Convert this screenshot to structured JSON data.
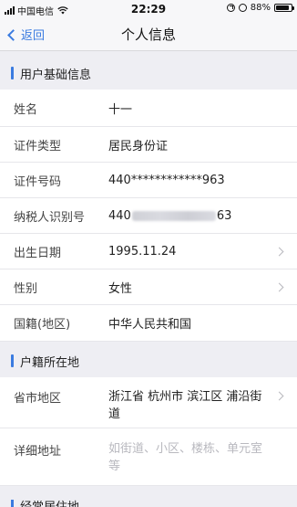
{
  "status_bar": {
    "carrier": "中国电信",
    "time": "22:29",
    "battery": "88%",
    "battery_level": 0.88
  },
  "nav": {
    "back_label": "返回",
    "title": "个人信息"
  },
  "sections": {
    "basic": {
      "title": "用户基础信息",
      "rows": [
        {
          "label": "姓名",
          "value": "十一"
        },
        {
          "label": "证件类型",
          "value": "居民身份证"
        },
        {
          "label": "证件号码",
          "value": "440************963"
        },
        {
          "label": "纳税人识别号",
          "value_prefix": "440",
          "value_suffix": "63"
        },
        {
          "label": "出生日期",
          "value": "1995.11.24"
        },
        {
          "label": "性别",
          "value": "女性"
        },
        {
          "label": "国籍(地区)",
          "value": "中华人民共和国"
        }
      ]
    },
    "household": {
      "title": "户籍所在地",
      "rows": [
        {
          "label": "省市地区",
          "value": "浙江省 杭州市 滨江区 浦沿街道"
        },
        {
          "label": "详细地址",
          "placeholder": "如街道、小区、楼栋、单元室等"
        }
      ]
    },
    "next": {
      "title": "经常居住地"
    }
  }
}
